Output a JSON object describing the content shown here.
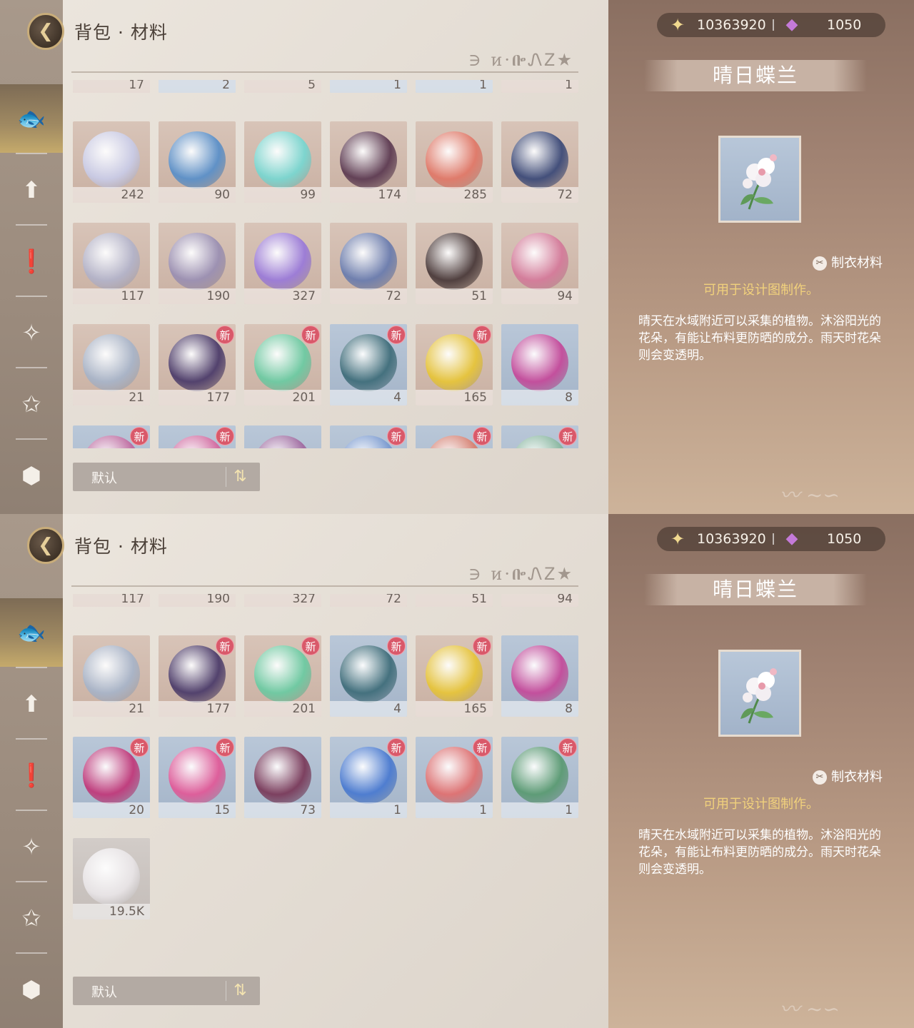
{
  "header": {
    "title": "背包 · 材料",
    "deco_text": "∋ ᴎ·ᎄᏁᏃ★"
  },
  "sidebar": {
    "tabs": [
      {
        "icon": "fish-icon",
        "glyph": "🐟",
        "active": true
      },
      {
        "icon": "arrow-up-icon",
        "glyph": "⬆",
        "active": false
      },
      {
        "icon": "exclamation-icon",
        "glyph": "❗",
        "active": false
      },
      {
        "icon": "crystal-icon",
        "glyph": "✧",
        "active": false
      },
      {
        "icon": "star-wand-icon",
        "glyph": "✩",
        "active": false
      },
      {
        "icon": "cube-icon",
        "glyph": "⬢",
        "active": false
      }
    ]
  },
  "currency": {
    "gold": "10363920",
    "gems": "1050",
    "gold_icon": "sparkle-star-icon",
    "gem_icon": "pink-gem-icon"
  },
  "detail": {
    "name": "晴日蝶兰",
    "category": "制衣材料",
    "usage": "可用于设计图制作。",
    "description": "晴天在水域附近可以采集的植物。沐浴阳光的花朵，有能让布料更防晒的成分。雨天时花朵则会变透明。"
  },
  "sort": {
    "label": "默认"
  },
  "new_badge": "新",
  "panels": [
    {
      "rows": [
        {
          "cut": "top",
          "items": [
            {
              "qty": "17",
              "tone": "warm",
              "color": "#c8b8b0"
            },
            {
              "qty": "2",
              "tone": "blue",
              "color": "#b6c4d4"
            },
            {
              "qty": "5",
              "tone": "warm",
              "color": "#c8b8b0"
            },
            {
              "qty": "1",
              "tone": "blue",
              "color": "#b6c4d4"
            },
            {
              "qty": "1",
              "tone": "blue",
              "color": "#b6c4d4"
            },
            {
              "qty": "1",
              "tone": "warm",
              "color": "#c8b8b0"
            }
          ]
        },
        {
          "items": [
            {
              "qty": "242",
              "tone": "warm",
              "color": "#c9cbe6",
              "new": false
            },
            {
              "qty": "90",
              "tone": "warm",
              "color": "#5a8fc8",
              "new": false
            },
            {
              "qty": "99",
              "tone": "warm",
              "color": "#79d6d0",
              "new": false
            },
            {
              "qty": "174",
              "tone": "warm",
              "color": "#5d3b52",
              "new": false
            },
            {
              "qty": "285",
              "tone": "warm",
              "color": "#e07868",
              "new": false
            },
            {
              "qty": "72",
              "tone": "warm",
              "color": "#3c4a78",
              "new": false
            }
          ]
        },
        {
          "items": [
            {
              "qty": "117",
              "tone": "warm",
              "color": "#b3b3c9",
              "new": false
            },
            {
              "qty": "190",
              "tone": "warm",
              "color": "#9a8fb2",
              "new": false
            },
            {
              "qty": "327",
              "tone": "warm",
              "color": "#9a7ad8",
              "new": false
            },
            {
              "qty": "72",
              "tone": "warm",
              "color": "#6a7cae",
              "new": false
            },
            {
              "qty": "51",
              "tone": "warm",
              "color": "#4a3a3a",
              "new": false
            },
            {
              "qty": "94",
              "tone": "warm",
              "color": "#d47a9a",
              "new": false
            }
          ]
        },
        {
          "items": [
            {
              "qty": "21",
              "tone": "warm",
              "color": "#a8b4c8",
              "new": false
            },
            {
              "qty": "177",
              "tone": "warm",
              "color": "#4c3c6a",
              "new": true
            },
            {
              "qty": "201",
              "tone": "warm",
              "color": "#6ccaa2",
              "new": true
            },
            {
              "qty": "4",
              "tone": "blue",
              "color": "#3f6d7a",
              "new": true
            },
            {
              "qty": "165",
              "tone": "warm",
              "color": "#e6c43a",
              "new": true
            },
            {
              "qty": "8",
              "tone": "blue",
              "color": "#c44a9a",
              "new": false
            }
          ]
        },
        {
          "cut": "bottom",
          "items": [
            {
              "qty": "",
              "tone": "blue",
              "color": "#c06aa0",
              "new": true
            },
            {
              "qty": "",
              "tone": "blue",
              "color": "#d46aa0",
              "new": true
            },
            {
              "qty": "",
              "tone": "blue",
              "color": "#a06aa0",
              "new": false
            },
            {
              "qty": "",
              "tone": "blue",
              "color": "#7a9ad0",
              "new": true
            },
            {
              "qty": "",
              "tone": "blue",
              "color": "#d88070",
              "new": true
            },
            {
              "qty": "",
              "tone": "blue",
              "color": "#8ab8a0",
              "new": true
            }
          ]
        }
      ]
    },
    {
      "rows": [
        {
          "cut": "top",
          "items": [
            {
              "qty": "117",
              "tone": "warm",
              "color": "#b3b3c9",
              "new": false
            },
            {
              "qty": "190",
              "tone": "warm",
              "color": "#9a8fb2",
              "new": false
            },
            {
              "qty": "327",
              "tone": "warm",
              "color": "#9a7ad8",
              "new": false
            },
            {
              "qty": "72",
              "tone": "warm",
              "color": "#6a7cae",
              "new": false
            },
            {
              "qty": "51",
              "tone": "warm",
              "color": "#4a3a3a",
              "new": false
            },
            {
              "qty": "94",
              "tone": "warm",
              "color": "#d47a9a",
              "new": false
            }
          ]
        },
        {
          "items": [
            {
              "qty": "21",
              "tone": "warm",
              "color": "#a8b4c8",
              "new": false
            },
            {
              "qty": "177",
              "tone": "warm",
              "color": "#4c3c6a",
              "new": true
            },
            {
              "qty": "201",
              "tone": "warm",
              "color": "#6ccaa2",
              "new": true
            },
            {
              "qty": "4",
              "tone": "blue",
              "color": "#3f6d7a",
              "new": true
            },
            {
              "qty": "165",
              "tone": "warm",
              "color": "#e6c43a",
              "new": true
            },
            {
              "qty": "8",
              "tone": "blue",
              "color": "#c44a9a",
              "new": false
            }
          ]
        },
        {
          "items": [
            {
              "qty": "20",
              "tone": "blue",
              "color": "#c0397a",
              "new": true
            },
            {
              "qty": "15",
              "tone": "blue",
              "color": "#e05a98",
              "new": true
            },
            {
              "qty": "73",
              "tone": "blue",
              "color": "#7a3a5a",
              "new": false
            },
            {
              "qty": "1",
              "tone": "blue",
              "color": "#4a7ad0",
              "new": true
            },
            {
              "qty": "1",
              "tone": "blue",
              "color": "#e07070",
              "new": true
            },
            {
              "qty": "1",
              "tone": "blue",
              "color": "#5a9a72",
              "new": true
            }
          ]
        },
        {
          "items": [
            {
              "qty": "19.5K",
              "tone": "gray",
              "color": "#e8e4e6",
              "new": false
            }
          ]
        }
      ]
    }
  ]
}
